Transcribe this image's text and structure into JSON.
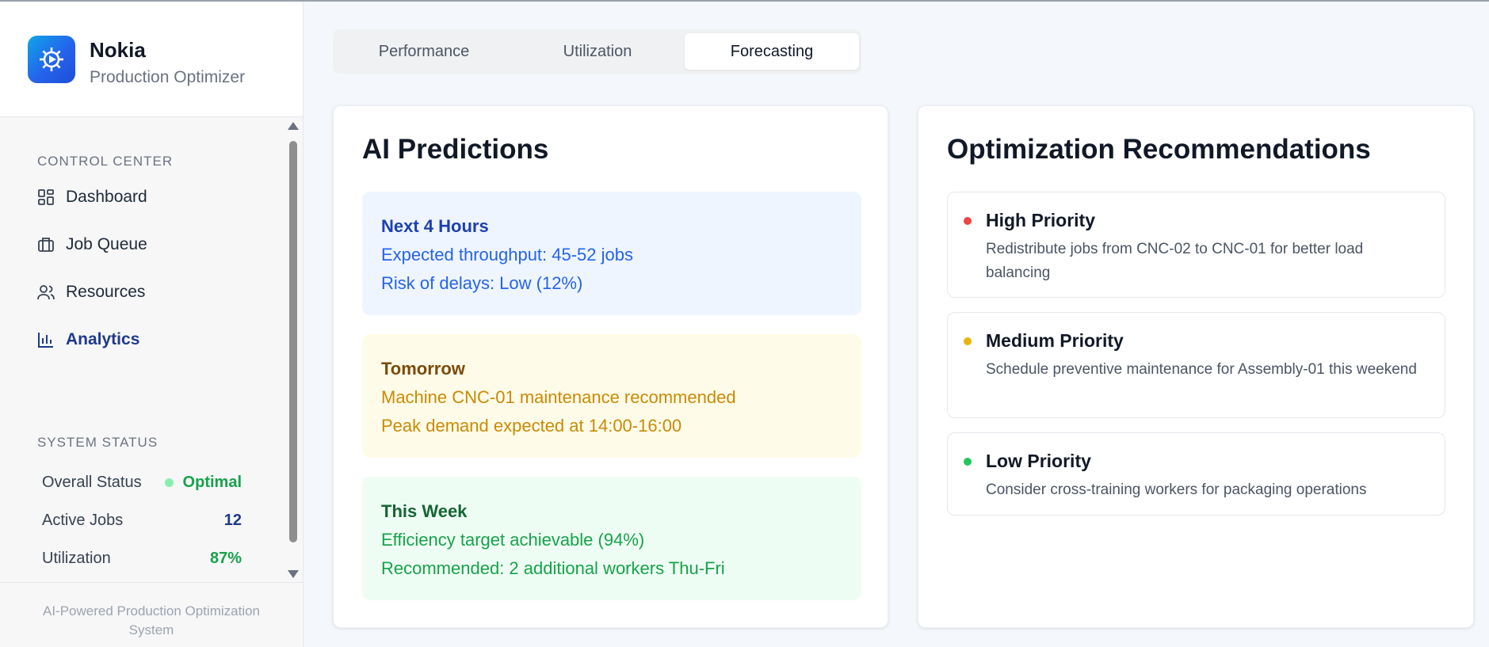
{
  "app": {
    "brand_name": "Nokia",
    "brand_subtitle": "Production Optimizer"
  },
  "sidebar": {
    "control_center_title": "CONTROL CENTER",
    "items": [
      {
        "label": "Dashboard",
        "icon": "dashboard-icon",
        "active": false
      },
      {
        "label": "Job Queue",
        "icon": "briefcase-icon",
        "active": false
      },
      {
        "label": "Resources",
        "icon": "users-icon",
        "active": false
      },
      {
        "label": "Analytics",
        "icon": "bar-chart-icon",
        "active": true
      }
    ],
    "system_status_title": "SYSTEM STATUS",
    "status": [
      {
        "label": "Overall Status",
        "value": "Optimal"
      },
      {
        "label": "Active Jobs",
        "value": "12"
      },
      {
        "label": "Utilization",
        "value": "87%"
      }
    ],
    "footer": "AI-Powered Production Optimization System"
  },
  "tabs": [
    {
      "label": "Performance",
      "active": false
    },
    {
      "label": "Utilization",
      "active": false
    },
    {
      "label": "Forecasting",
      "active": true
    }
  ],
  "predictions": {
    "title": "AI Predictions",
    "items": [
      {
        "heading": "Next 4 Hours",
        "lines": [
          "Expected throughput: 45-52 jobs",
          "Risk of delays: Low (12%)"
        ],
        "tone": "blue"
      },
      {
        "heading": "Tomorrow",
        "lines": [
          "Machine CNC-01 maintenance recommended",
          "Peak demand expected at 14:00-16:00"
        ],
        "tone": "amber"
      },
      {
        "heading": "This Week",
        "lines": [
          "Efficiency target achievable (94%)",
          "Recommended: 2 additional workers Thu-Fri"
        ],
        "tone": "green"
      }
    ]
  },
  "recommendations": {
    "title": "Optimization Recommendations",
    "items": [
      {
        "priority": "High Priority",
        "text": "Redistribute jobs from CNC-02 to CNC-01 for better load balancing",
        "color": "#ef4444"
      },
      {
        "priority": "Medium Priority",
        "text": "Schedule preventive maintenance for Assembly-01 this weekend",
        "color": "#eab308"
      },
      {
        "priority": "Low Priority",
        "text": "Consider cross-training workers for packaging operations",
        "color": "#22c55e"
      }
    ]
  }
}
